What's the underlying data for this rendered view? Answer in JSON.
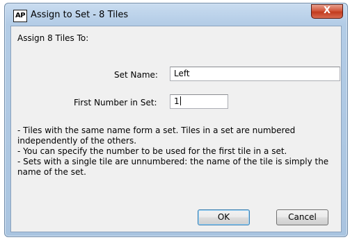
{
  "window": {
    "app_icon_text": "AP",
    "title": "Assign to Set - 8 Tiles",
    "close_glyph": "X"
  },
  "form": {
    "heading": "Assign 8 Tiles To:",
    "set_name_label": "Set Name:",
    "set_name_value": "Left",
    "first_number_label": "First Number in Set:",
    "first_number_value": "1"
  },
  "help_lines": [
    "- Tiles with the same name form a set. Tiles in a set are numbered independently of the others.",
    "- You can specify the number to be used for the first tile in a set.",
    "- Sets with a single tile are unnumbered: the name of the tile is simply the name of the set."
  ],
  "buttons": {
    "ok": "OK",
    "cancel": "Cancel"
  },
  "colors": {
    "title_bar": "#b3cce6",
    "close_button": "#c23b1e",
    "client_bg": "#f0f0f0",
    "default_button_border": "#3c7fb1"
  }
}
